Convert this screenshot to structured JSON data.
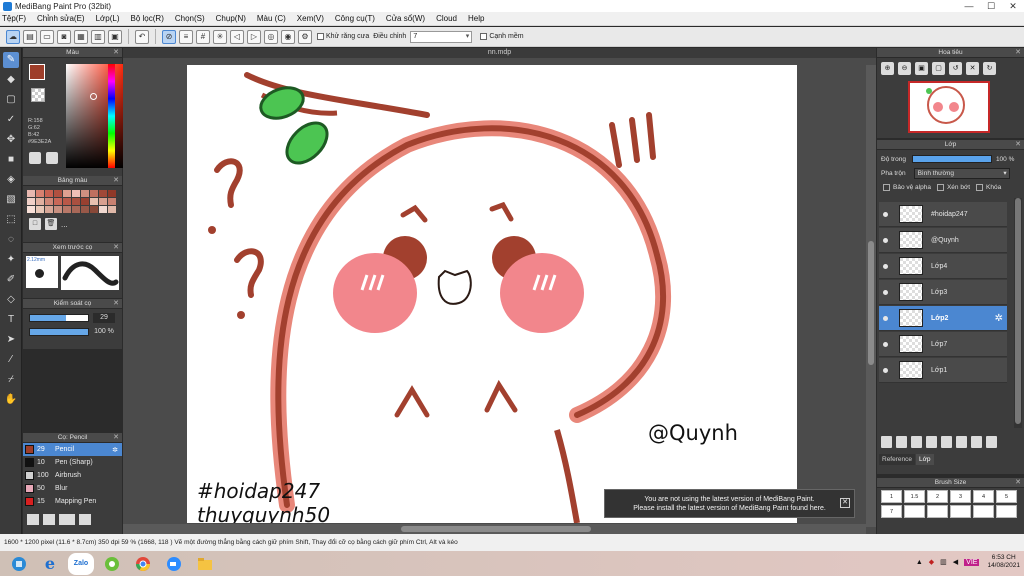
{
  "titlebar": {
    "title": "MediBang Paint Pro (32bit)",
    "minimize": "—",
    "maximize": "☐",
    "close": "✕"
  },
  "menu": [
    "Tệp(F)",
    "Chỉnh sửa(E)",
    "Lớp(L)",
    "Bộ lọc(R)",
    "Chọn(S)",
    "Chụp(N)",
    "Màu (C)",
    "Xem(V)",
    "Công cụ(T)",
    "Cửa sổ(W)",
    "Cloud",
    "Help"
  ],
  "toolbar": {
    "antialias_label": "Khử răng cưa",
    "correction_label": "Điều chỉnh",
    "correction_value": "7",
    "edge_label": "Cạnh mềm"
  },
  "color_panel": {
    "title": "Màu",
    "main_color": "#9e3e2a",
    "r": "R:158",
    "g": "G:62",
    "b": "B:42",
    "hex": "#9E3E2A"
  },
  "palette": {
    "title": "Bảng màu",
    "colors": [
      "#e8b8b0",
      "#d88070",
      "#c86050",
      "#b05040",
      "#e0a090",
      "#f0c0b8",
      "#d09080",
      "#c07060",
      "#a04838",
      "#903828",
      "#f0d0c8",
      "#e0b0a0",
      "#d08878",
      "#c86858",
      "#b85848",
      "#a85040",
      "#984030",
      "#e8c0b0",
      "#d8a090",
      "#c88070",
      "#f8e0d8",
      "#e8c8b8",
      "#d8a898",
      "#c89080",
      "#b87868",
      "#a86858",
      "#985848",
      "#884838",
      "#f0d8d0",
      "#e0b8a8"
    ],
    "more": "..."
  },
  "brush_preview": {
    "title": "Xem trước cọ",
    "size": "2.12mm"
  },
  "control": {
    "title": "Kiểm soát cọ",
    "size_value": "29",
    "size_fraction": 0.62,
    "opacity_value": "100 %",
    "opacity_fraction": 1.0
  },
  "brush_panel": {
    "title": "Cọ: Pencil",
    "items": [
      {
        "size": "29",
        "name": "Pencil",
        "color": "#9e3e2a",
        "active": true
      },
      {
        "size": "10",
        "name": "Pen (Sharp)",
        "color": "#111111",
        "active": false
      },
      {
        "size": "100",
        "name": "Airbrush",
        "color": "#d0d0d0",
        "active": false
      },
      {
        "size": "50",
        "name": "Blur",
        "color": "#e8a8b8",
        "active": false
      },
      {
        "size": "15",
        "name": "Mapping Pen",
        "color": "#d82020",
        "active": false
      }
    ]
  },
  "canvas": {
    "tab": "nn.mdp",
    "texts": {
      "tag1": "#hoidap247",
      "tag2": "thuyquynh50",
      "handle": "@Quynh",
      "exclaim": "!!!"
    }
  },
  "notice": {
    "line1": "You are not using the latest version of MediBang Paint.",
    "line2": "Please install the latest version of MediBang Paint found here.",
    "close": "✕"
  },
  "navigator": {
    "title": "Hoa tiêu"
  },
  "layers": {
    "title": "Lớp",
    "opacity_label": "Độ trong",
    "opacity_value": "100 %",
    "blend_label": "Pha trộn",
    "blend_value": "Bình thường",
    "protect_alpha": "Bảo vệ alpha",
    "clipping": "Xén bớt",
    "lock": "Khóa",
    "items": [
      {
        "name": "#hoidap247",
        "active": false
      },
      {
        "name": "@Quynh",
        "active": false
      },
      {
        "name": "Lớp4",
        "active": false
      },
      {
        "name": "Lớp3",
        "active": false
      },
      {
        "name": "Lớp2",
        "active": true
      },
      {
        "name": "Lớp7",
        "active": false
      },
      {
        "name": "Lớp1",
        "active": false
      }
    ],
    "tab_reference": "Reference",
    "tab_layer": "Lớp"
  },
  "brush_size": {
    "title": "Brush Size",
    "values": [
      "1",
      "1.5",
      "2",
      "3",
      "4",
      "5",
      "7",
      "",
      "",
      "",
      "",
      "",
      ""
    ]
  },
  "status": {
    "text": "1600 * 1200 pixel  (11.6 * 8.7cm)  350 dpi  59 %  (1668, 118 )  Vẽ một đường thẳng bằng cách giữ phím Shift, Thay đổi cỡ cọ bằng cách giữ phím Ctrl, Alt và kéo"
  },
  "taskbar": {
    "zalo": "Zalo",
    "lang": "VIE",
    "time": "6:53 CH",
    "date": "14/08/2021"
  }
}
